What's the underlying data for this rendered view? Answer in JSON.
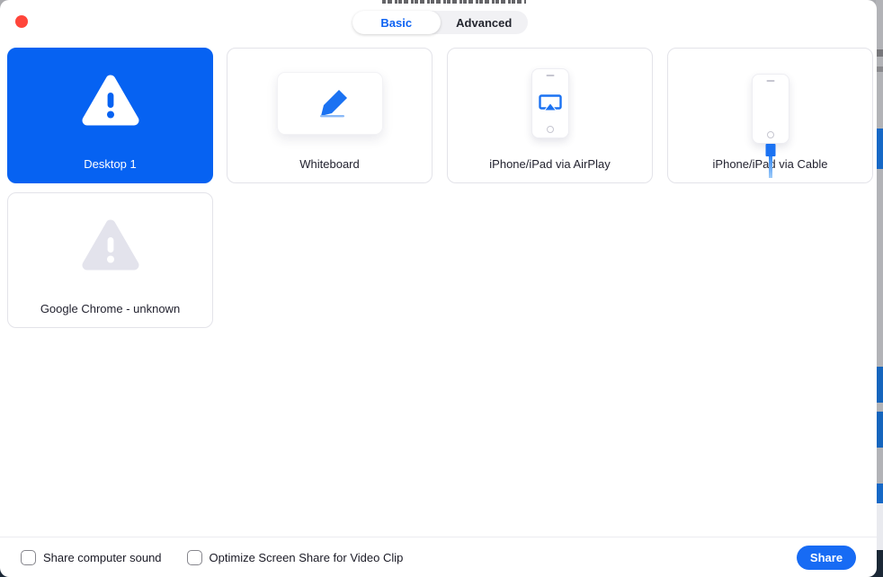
{
  "tabs": {
    "items": [
      {
        "label": "Basic",
        "selected": true
      },
      {
        "label": "Advanced",
        "selected": false
      }
    ]
  },
  "tiles": [
    {
      "label": "Desktop 1",
      "icon": "warning-triangle",
      "selected": true
    },
    {
      "label": "Whiteboard",
      "icon": "pen",
      "selected": false
    },
    {
      "label": "iPhone/iPad via AirPlay",
      "icon": "phone-airplay",
      "selected": false
    },
    {
      "label": "iPhone/iPad via Cable",
      "icon": "phone-cable",
      "selected": false
    },
    {
      "label": "Google Chrome - unknown",
      "icon": "warning-triangle-gray",
      "selected": false
    }
  ],
  "footer": {
    "checkboxes": [
      {
        "label": "Share computer sound",
        "checked": false
      },
      {
        "label": "Optimize Screen Share for Video Clip",
        "checked": false
      }
    ],
    "share_button": "Share"
  },
  "colors": {
    "selected_tile_blue": "#0662f2",
    "accent_blue": "#0e63f2",
    "share_button_blue": "#176bf4",
    "close_button_red": "#ff453a",
    "muted_icon_gray": "#e3e3ec"
  }
}
